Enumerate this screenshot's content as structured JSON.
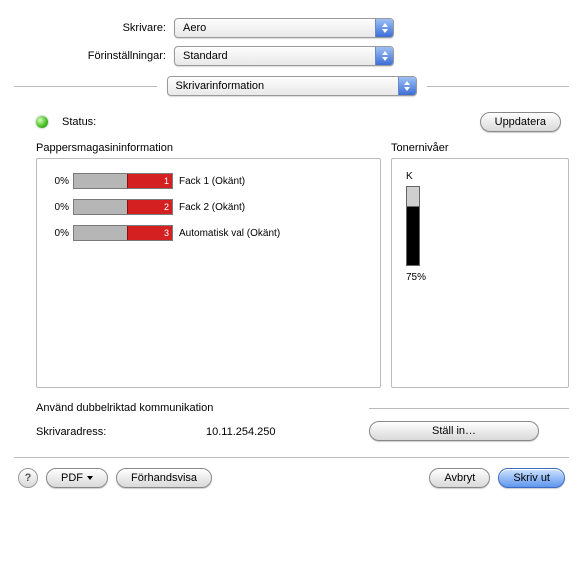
{
  "header": {
    "printer_label": "Skrivare:",
    "printer_value": "Aero",
    "preset_label": "Förinställningar:",
    "preset_value": "Standard"
  },
  "section_select": "Skrivarinformation",
  "status": {
    "label": "Status:",
    "update_btn": "Uppdatera"
  },
  "trays": {
    "title": "Pappersmagasininformation",
    "items": [
      {
        "pct": "0%",
        "num": "1",
        "label": "Fack 1 (Okänt)"
      },
      {
        "pct": "0%",
        "num": "2",
        "label": "Fack 2 (Okänt)"
      },
      {
        "pct": "0%",
        "num": "3",
        "label": "Automatisk val (Okänt)"
      }
    ]
  },
  "toner": {
    "title": "Tonernivåer",
    "name": "K",
    "pct": "75%"
  },
  "comm": {
    "title": "Använd dubbelriktad kommunikation",
    "addr_label": "Skrivaradress:",
    "addr_value": "10.11.254.250",
    "setup_btn": "Ställ in…"
  },
  "footer": {
    "help": "?",
    "pdf": "PDF",
    "preview": "Förhandsvisa",
    "cancel": "Avbryt",
    "print": "Skriv ut"
  }
}
